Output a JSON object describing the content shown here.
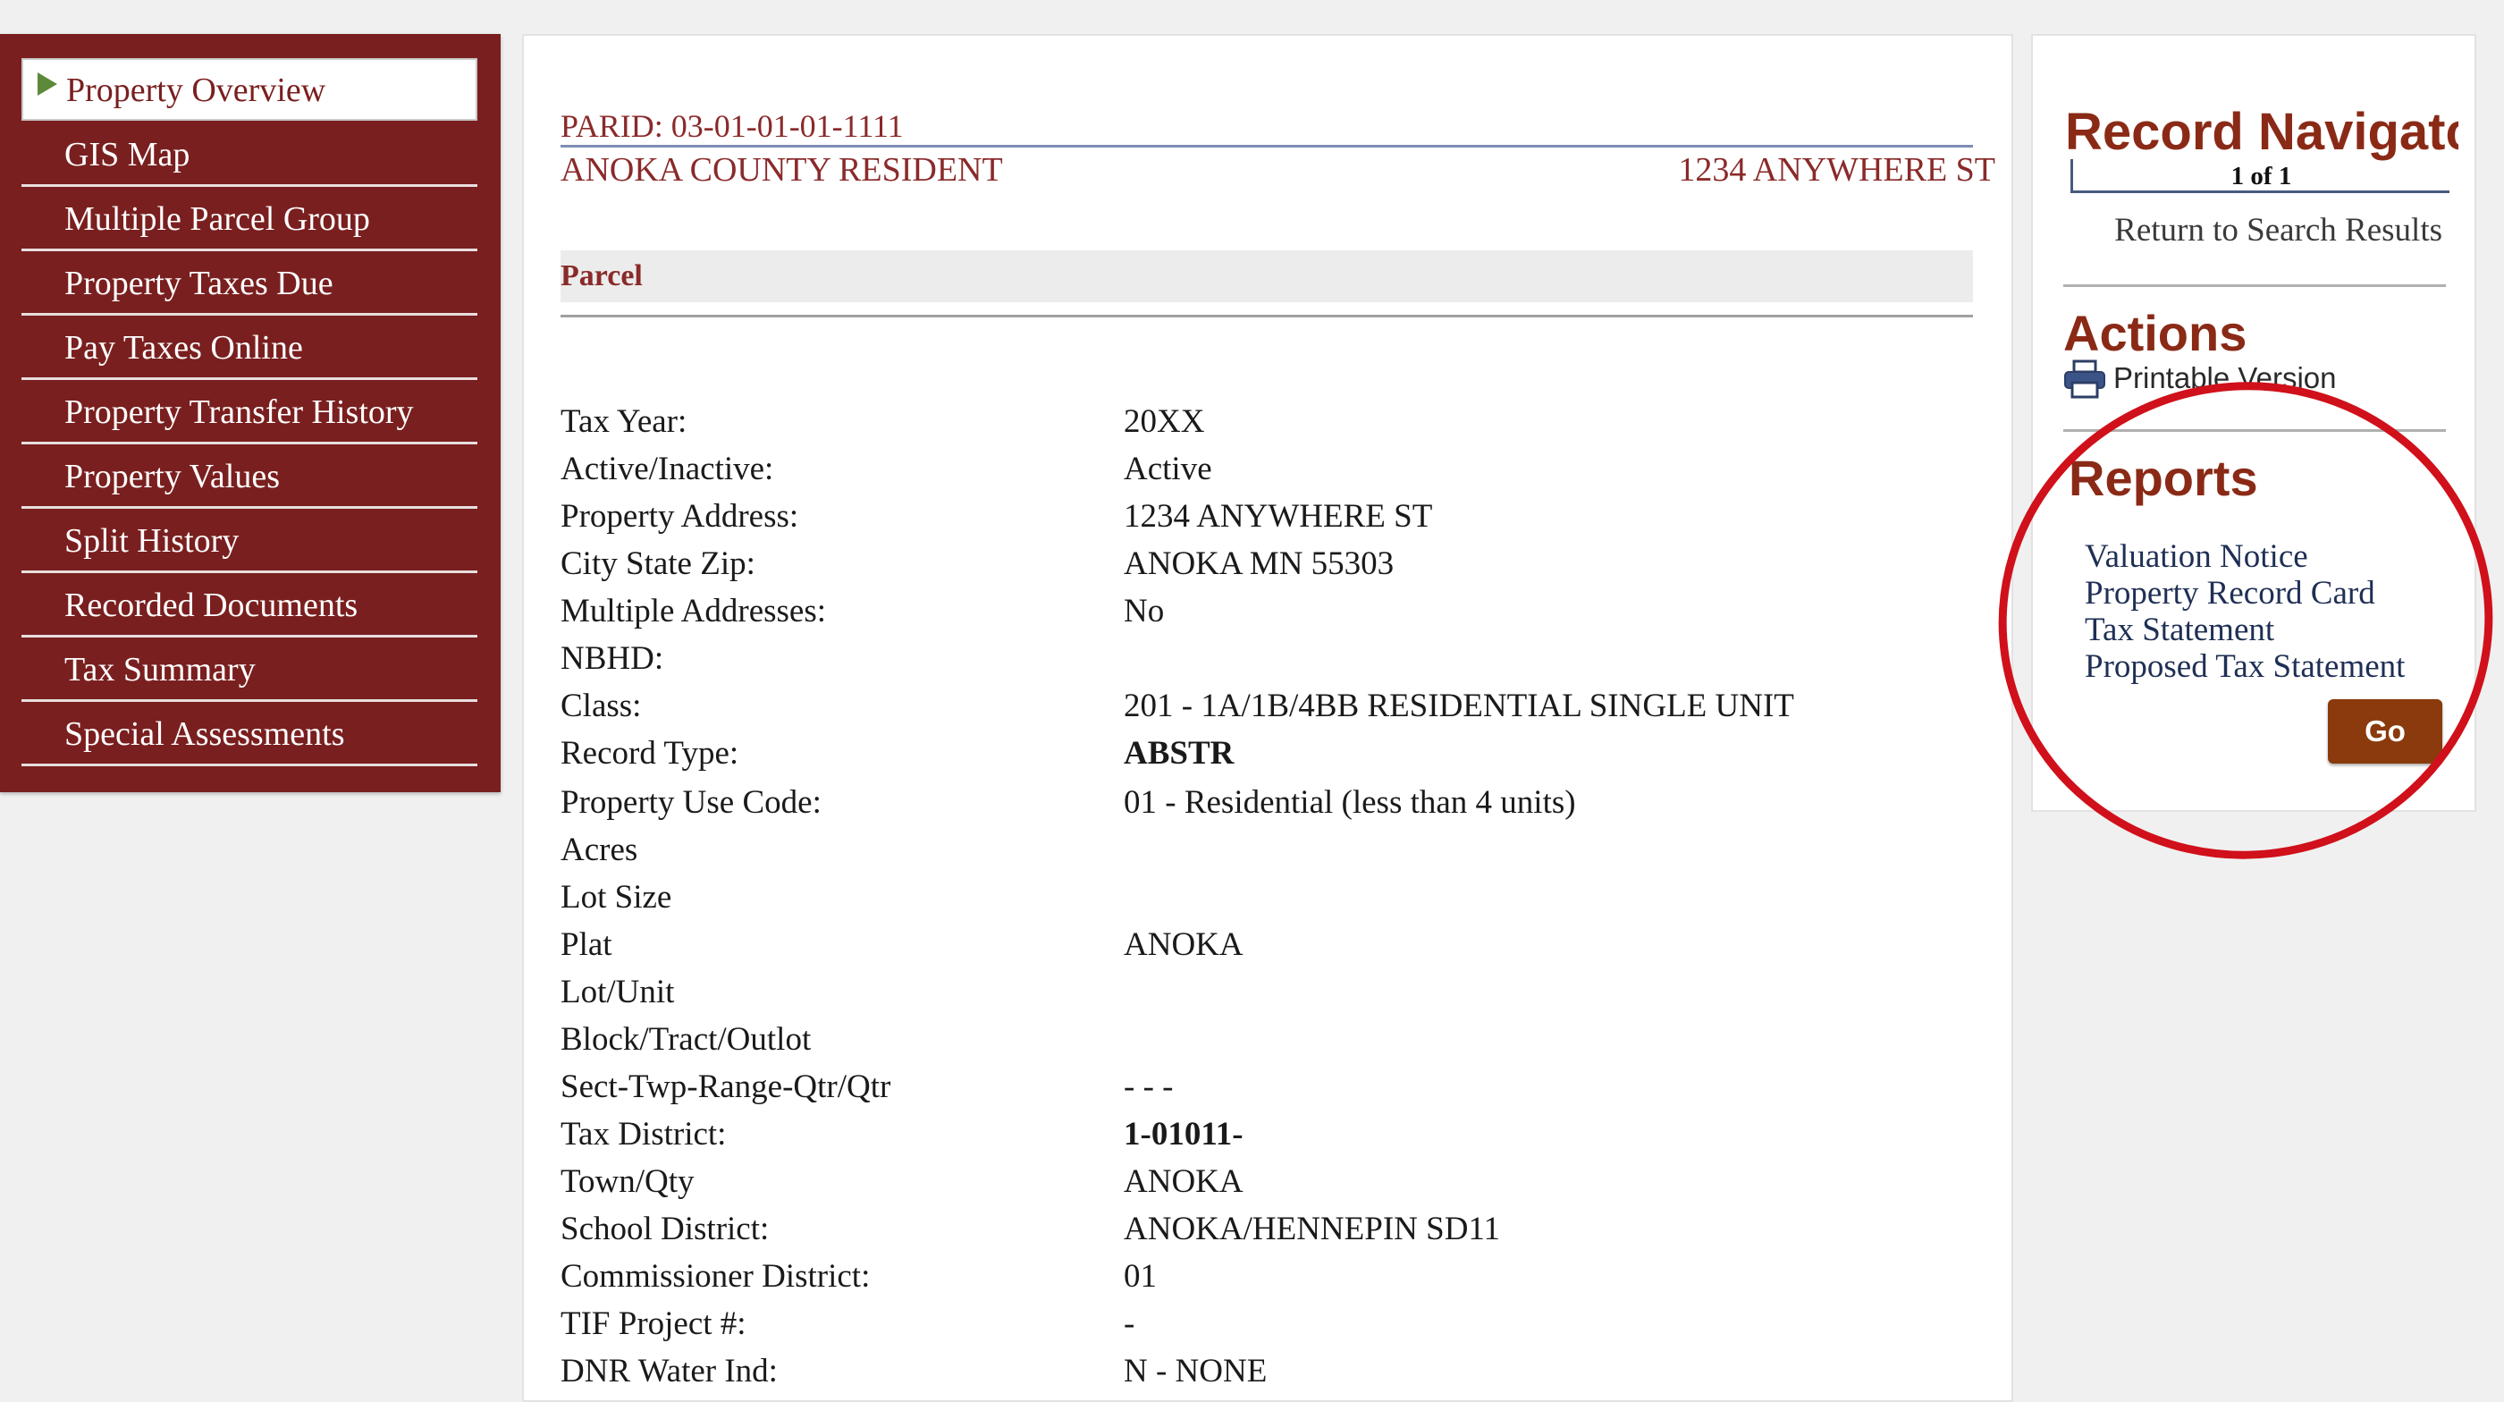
{
  "sidebar": {
    "items": [
      {
        "label": "Property Overview"
      },
      {
        "label": "GIS Map"
      },
      {
        "label": "Multiple Parcel Group"
      },
      {
        "label": "Property Taxes Due"
      },
      {
        "label": "Pay Taxes Online"
      },
      {
        "label": "Property Transfer History"
      },
      {
        "label": "Property Values"
      },
      {
        "label": "Split History"
      },
      {
        "label": "Recorded Documents"
      },
      {
        "label": "Tax Summary"
      },
      {
        "label": "Special Assessments"
      }
    ],
    "active_index": 0
  },
  "header": {
    "parid": "PARID: 03-01-01-01-1111",
    "owner": "ANOKA COUNTY RESIDENT",
    "address": "1234 ANYWHERE ST"
  },
  "parcel": {
    "title": "Parcel",
    "fields": [
      {
        "label": "Tax Year:",
        "value": "20XX"
      },
      {
        "label": "Active/Inactive:",
        "value": "Active"
      },
      {
        "label": "Property Address:",
        "value": "1234 ANYWHERE ST"
      },
      {
        "label": "City State Zip:",
        "value": "ANOKA MN 55303"
      },
      {
        "label": "Multiple Addresses:",
        "value": "No"
      },
      {
        "label": "NBHD:",
        "value": ""
      },
      {
        "label": "Class:",
        "value": "201 - 1A/1B/4BB RESIDENTIAL SINGLE UNIT"
      },
      {
        "label": "Record Type:",
        "value": "ABSTR"
      },
      {
        "label": "Property Use Code:",
        "value": "01 - Residential (less than 4 units)"
      },
      {
        "label": "Acres",
        "value": ""
      },
      {
        "label": "Lot Size",
        "value": ""
      },
      {
        "label": "Plat",
        "value": "ANOKA"
      },
      {
        "label": "Lot/Unit",
        "value": ""
      },
      {
        "label": "Block/Tract/Outlot",
        "value": ""
      },
      {
        "label": "Sect-Twp-Range-Qtr/Qtr",
        "value": "- - -"
      },
      {
        "label": "Tax District:",
        "value": "1-01011-"
      },
      {
        "label": "Town/Qty",
        "value": "ANOKA"
      },
      {
        "label": "School District:",
        "value": "ANOKA/HENNEPIN SD11"
      },
      {
        "label": "Commissioner District:",
        "value": "01"
      },
      {
        "label": "TIF Project #:",
        "value": "-"
      },
      {
        "label": "DNR Water Ind:",
        "value": "N - NONE"
      }
    ]
  },
  "record_navigation": {
    "title": "Record Navigatc",
    "count": "1 of 1",
    "return_label": "Return to Search Results"
  },
  "actions": {
    "title": "Actions",
    "printable_label": "Printable Version",
    "printer_icon": "printer-icon"
  },
  "reports": {
    "title": "Reports",
    "items": [
      "Valuation Notice",
      "Property Record Card",
      "Tax Statement",
      "Proposed Tax Statement"
    ],
    "go_label": "Go"
  },
  "colors": {
    "sidebar_bg": "#7a1f1f",
    "accent_text": "#8a2a2a",
    "go_button": "#8a3a0c",
    "annotation": "#d0101a"
  }
}
